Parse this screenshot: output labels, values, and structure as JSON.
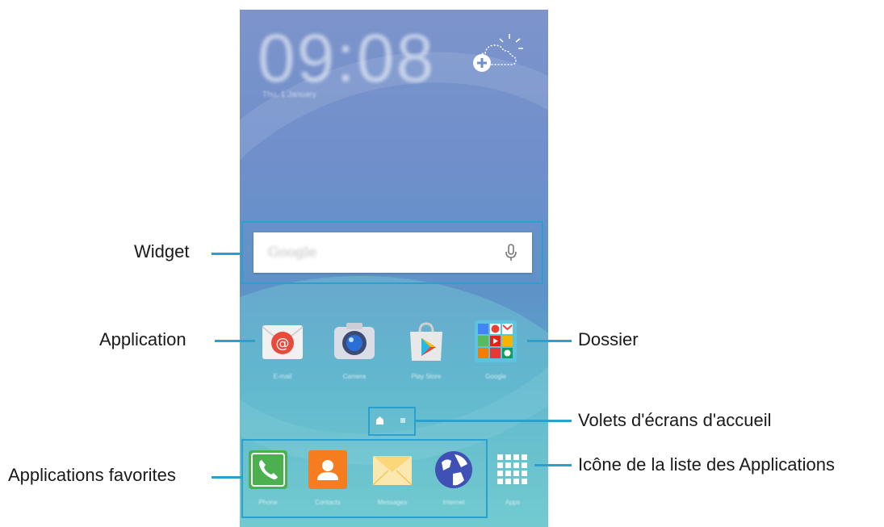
{
  "clock": {
    "time": "09:08",
    "date": "Thu, 1 January"
  },
  "search_widget": {
    "placeholder": "Google"
  },
  "apps": [
    {
      "label": "E-mail",
      "icon": "email-icon"
    },
    {
      "label": "Camera",
      "icon": "camera-icon"
    },
    {
      "label": "Play Store",
      "icon": "play-store-icon"
    },
    {
      "label": "Google",
      "icon": "folder-icon"
    }
  ],
  "favorites": [
    {
      "label": "Phone",
      "icon": "phone-icon"
    },
    {
      "label": "Contacts",
      "icon": "contacts-icon"
    },
    {
      "label": "Messages",
      "icon": "messages-icon"
    },
    {
      "label": "Internet",
      "icon": "internet-icon"
    }
  ],
  "apps_button": {
    "label": "Apps",
    "icon": "apps-grid-icon"
  },
  "callouts": {
    "widget": "Widget",
    "application": "Application",
    "folder": "Dossier",
    "panels": "Volets d'écrans d'accueil",
    "favorites": "Applications favorites",
    "apps_list": "Icône de la liste des Applications"
  },
  "colors": {
    "callout_line": "#2aa0cf"
  }
}
